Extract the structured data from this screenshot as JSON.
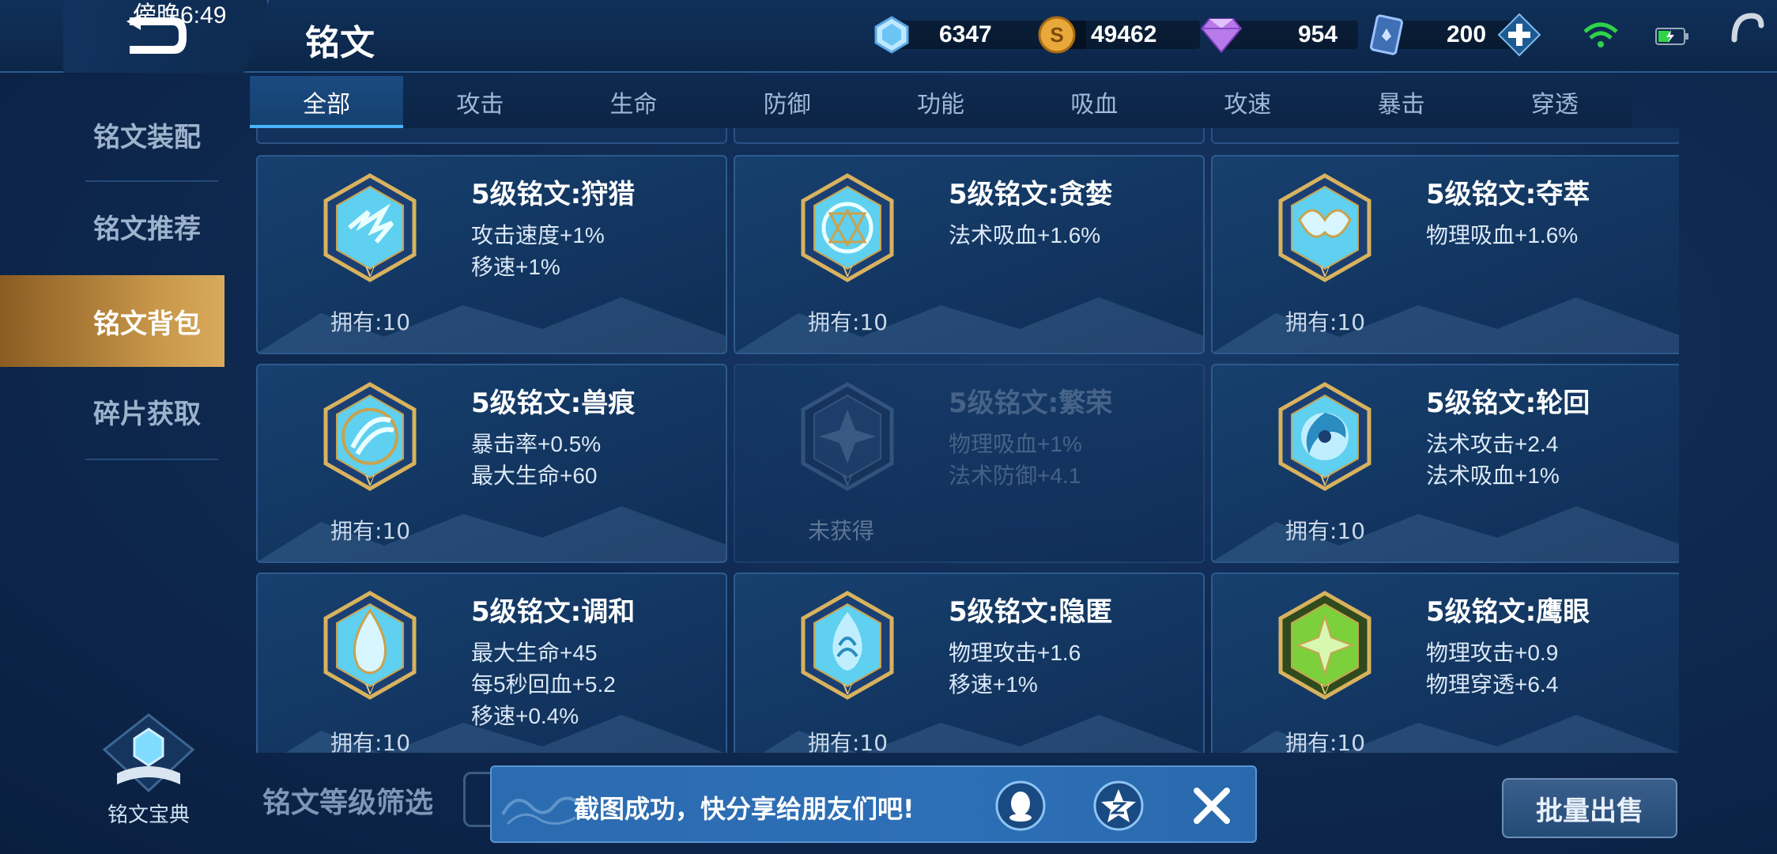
{
  "status_bar": {
    "time": "傍晚6:49"
  },
  "header": {
    "title": "铭文",
    "currencies": [
      {
        "icon": "crystal-icon",
        "value": "6347"
      },
      {
        "icon": "gold-coin-icon",
        "value": "49462"
      },
      {
        "icon": "diamond-icon",
        "value": "954"
      },
      {
        "icon": "voucher-icon",
        "value": "200"
      }
    ]
  },
  "tabs": [
    "全部",
    "攻击",
    "生命",
    "防御",
    "功能",
    "吸血",
    "攻速",
    "暴击",
    "穿透"
  ],
  "active_tab": "全部",
  "sidebar": {
    "items": [
      {
        "label": "铭文装配"
      },
      {
        "label": "铭文推荐"
      },
      {
        "label": "铭文背包",
        "active": true
      },
      {
        "label": "碎片获取"
      }
    ],
    "codex_label": "铭文宝典"
  },
  "cards": [
    {
      "name": "5级铭文:狩猎",
      "stats": [
        "攻击速度+1%",
        "移速+1%"
      ],
      "owned": "拥有:10",
      "color": "#5fd0f0",
      "acquired": true
    },
    {
      "name": "5级铭文:贪婪",
      "stats": [
        "法术吸血+1.6%"
      ],
      "owned": "拥有:10",
      "color": "#5fd0f0",
      "acquired": true
    },
    {
      "name": "5级铭文:夺萃",
      "stats": [
        "物理吸血+1.6%"
      ],
      "owned": "拥有:10",
      "color": "#5fd0f0",
      "acquired": true
    },
    {
      "name": "5级铭文:兽痕",
      "stats": [
        "暴击率+0.5%",
        "最大生命+60"
      ],
      "owned": "拥有:10",
      "color": "#5fd0f0",
      "acquired": true
    },
    {
      "name": "5级铭文:繁荣",
      "stats": [
        "物理吸血+1%",
        "法术防御+4.1"
      ],
      "owned": "未获得",
      "color": "#5a7fa8",
      "acquired": false
    },
    {
      "name": "5级铭文:轮回",
      "stats": [
        "法术攻击+2.4",
        "法术吸血+1%"
      ],
      "owned": "拥有:10",
      "color": "#5fd0f0",
      "acquired": true
    },
    {
      "name": "5级铭文:调和",
      "stats": [
        "最大生命+45",
        "每5秒回血+5.2",
        "移速+0.4%"
      ],
      "owned": "拥有:10",
      "color": "#5fd0f0",
      "acquired": true
    },
    {
      "name": "5级铭文:隐匿",
      "stats": [
        "物理攻击+1.6",
        "移速+1%"
      ],
      "owned": "拥有:10",
      "color": "#5fd0f0",
      "acquired": true
    },
    {
      "name": "5级铭文:鹰眼",
      "stats": [
        "物理攻击+0.9",
        "物理穿透+6.4"
      ],
      "owned": "拥有:10",
      "color": "#7cd03c",
      "acquired": true
    }
  ],
  "footer": {
    "filter_label": "铭文等级筛选",
    "sell_button": "批量出售"
  },
  "toast": {
    "message": "截图成功，快分享给朋友们吧!"
  }
}
